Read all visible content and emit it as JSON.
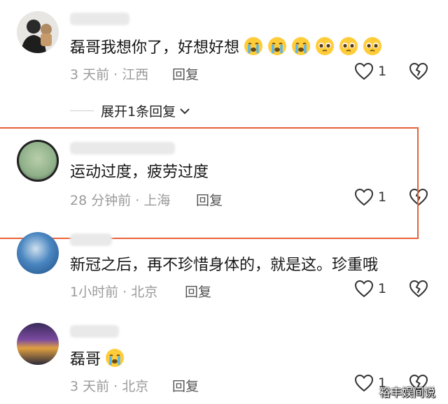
{
  "comments": [
    {
      "text": "磊哥我想你了，好想好想",
      "emojis": [
        "loudly-crying-face",
        "loudly-crying-face",
        "loudly-crying-face",
        "pleading-face",
        "pleading-face",
        "pleading-face"
      ],
      "meta": "3 天前 · 江西",
      "reply_label": "回复",
      "likes": "1"
    },
    {
      "text": "运动过度，疲劳过度",
      "emojis": [],
      "meta": "28 分钟前 · 上海",
      "reply_label": "回复",
      "likes": "1"
    },
    {
      "text": "新冠之后，再不珍惜身体的，就是这。珍重哦",
      "emojis": [],
      "meta": "1小时前 · 北京",
      "reply_label": "回复",
      "likes": "1"
    },
    {
      "text": "磊哥",
      "emojis": [
        "loudly-crying-face"
      ],
      "meta": "3 天前 · 北京",
      "reply_label": "回复",
      "likes": "1"
    }
  ],
  "expand_replies": {
    "label": "展开1条回复",
    "icon": "chevron-down-icon"
  },
  "highlight_color": "#e8613a",
  "watermark": "裕丰娱间说",
  "icons": {
    "like": "heart-outline-icon",
    "dislike": "broken-heart-icon"
  }
}
